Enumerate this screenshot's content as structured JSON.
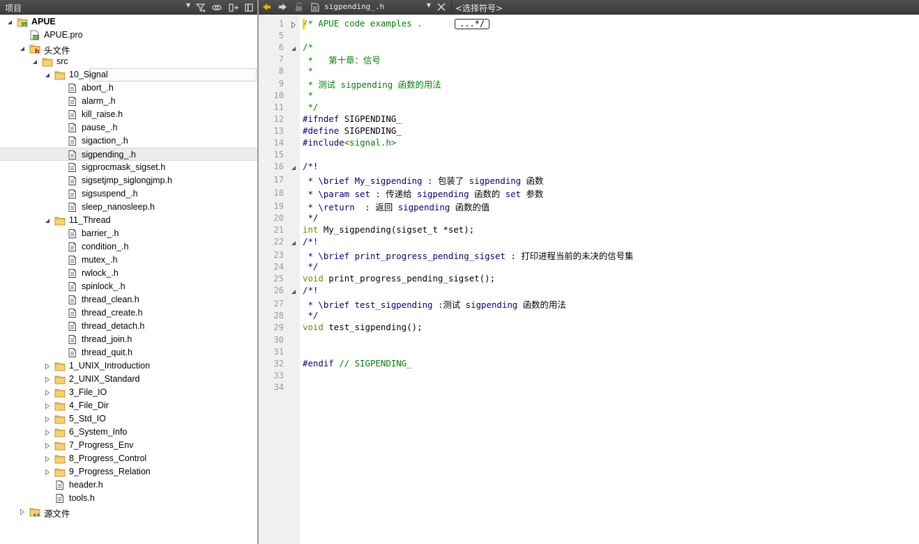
{
  "left_pane": {
    "header_title": "项目",
    "tree": [
      {
        "label": "APUE",
        "indent": 0,
        "expander": "open",
        "icon": "project-icon",
        "bold": true
      },
      {
        "label": "APUE.pro",
        "indent": 1,
        "expander": "none",
        "icon": "pro-file-icon"
      },
      {
        "label": "头文件",
        "indent": 1,
        "expander": "open",
        "icon": "headers-folder-icon"
      },
      {
        "label": "src",
        "indent": 2,
        "expander": "open",
        "icon": "folder-icon"
      },
      {
        "label": "10_Signal",
        "indent": 3,
        "expander": "open",
        "icon": "folder-icon",
        "state": "outline"
      },
      {
        "label": "abort_.h",
        "indent": 4,
        "expander": "none",
        "icon": "header-file-icon"
      },
      {
        "label": "alarm_.h",
        "indent": 4,
        "expander": "none",
        "icon": "header-file-icon"
      },
      {
        "label": "kill_raise.h",
        "indent": 4,
        "expander": "none",
        "icon": "header-file-icon"
      },
      {
        "label": "pause_.h",
        "indent": 4,
        "expander": "none",
        "icon": "header-file-icon"
      },
      {
        "label": "sigaction_.h",
        "indent": 4,
        "expander": "none",
        "icon": "header-file-icon"
      },
      {
        "label": "sigpending_.h",
        "indent": 4,
        "expander": "none",
        "icon": "header-file-icon",
        "state": "selected"
      },
      {
        "label": "sigprocmask_sigset.h",
        "indent": 4,
        "expander": "none",
        "icon": "header-file-icon"
      },
      {
        "label": "sigsetjmp_siglongjmp.h",
        "indent": 4,
        "expander": "none",
        "icon": "header-file-icon"
      },
      {
        "label": "sigsuspend_.h",
        "indent": 4,
        "expander": "none",
        "icon": "header-file-icon"
      },
      {
        "label": "sleep_nanosleep.h",
        "indent": 4,
        "expander": "none",
        "icon": "header-file-icon"
      },
      {
        "label": "11_Thread",
        "indent": 3,
        "expander": "open",
        "icon": "folder-icon"
      },
      {
        "label": "barrier_.h",
        "indent": 4,
        "expander": "none",
        "icon": "header-file-icon"
      },
      {
        "label": "condition_.h",
        "indent": 4,
        "expander": "none",
        "icon": "header-file-icon"
      },
      {
        "label": "mutex_.h",
        "indent": 4,
        "expander": "none",
        "icon": "header-file-icon"
      },
      {
        "label": "rwlock_.h",
        "indent": 4,
        "expander": "none",
        "icon": "header-file-icon"
      },
      {
        "label": "spinlock_.h",
        "indent": 4,
        "expander": "none",
        "icon": "header-file-icon"
      },
      {
        "label": "thread_clean.h",
        "indent": 4,
        "expander": "none",
        "icon": "header-file-icon"
      },
      {
        "label": "thread_create.h",
        "indent": 4,
        "expander": "none",
        "icon": "header-file-icon"
      },
      {
        "label": "thread_detach.h",
        "indent": 4,
        "expander": "none",
        "icon": "header-file-icon"
      },
      {
        "label": "thread_join.h",
        "indent": 4,
        "expander": "none",
        "icon": "header-file-icon"
      },
      {
        "label": "thread_quit.h",
        "indent": 4,
        "expander": "none",
        "icon": "header-file-icon"
      },
      {
        "label": "1_UNIX_Introduction",
        "indent": 3,
        "expander": "closed",
        "icon": "folder-icon"
      },
      {
        "label": "2_UNIX_Standard",
        "indent": 3,
        "expander": "closed",
        "icon": "folder-icon"
      },
      {
        "label": "3_File_IO",
        "indent": 3,
        "expander": "closed",
        "icon": "folder-icon"
      },
      {
        "label": "4_File_Dir",
        "indent": 3,
        "expander": "closed",
        "icon": "folder-icon"
      },
      {
        "label": "5_Std_IO",
        "indent": 3,
        "expander": "closed",
        "icon": "folder-icon"
      },
      {
        "label": "6_System_Info",
        "indent": 3,
        "expander": "closed",
        "icon": "folder-icon"
      },
      {
        "label": "7_Progress_Env",
        "indent": 3,
        "expander": "closed",
        "icon": "folder-icon"
      },
      {
        "label": "8_Progress_Control",
        "indent": 3,
        "expander": "closed",
        "icon": "folder-icon"
      },
      {
        "label": "9_Progress_Relation",
        "indent": 3,
        "expander": "closed",
        "icon": "folder-icon"
      },
      {
        "label": "header.h",
        "indent": 3,
        "expander": "none",
        "icon": "header-file-icon"
      },
      {
        "label": "tools.h",
        "indent": 3,
        "expander": "none",
        "icon": "header-file-icon"
      },
      {
        "label": "源文件",
        "indent": 1,
        "expander": "closed",
        "icon": "sources-folder-icon"
      }
    ]
  },
  "editor": {
    "file_name": "sigpending_.h",
    "symbol_placeholder": "<选择符号>",
    "collapsed_marker": "...*/",
    "line_numbers": [
      1,
      5,
      6,
      7,
      8,
      9,
      10,
      11,
      12,
      13,
      14,
      15,
      16,
      17,
      18,
      19,
      20,
      21,
      22,
      23,
      24,
      25,
      26,
      27,
      28,
      29,
      30,
      31,
      32,
      33,
      34
    ],
    "fold_markers": [
      {
        "line": 1,
        "kind": "collapsed"
      },
      {
        "line": 6,
        "kind": "expanded"
      },
      {
        "line": 16,
        "kind": "expanded"
      },
      {
        "line": 22,
        "kind": "expanded"
      },
      {
        "line": 26,
        "kind": "expanded"
      }
    ],
    "lines": [
      {
        "n": 1,
        "segs": [
          [
            "c-green",
            "/* APUE code examples . "
          ]
        ]
      },
      {
        "n": 5,
        "segs": []
      },
      {
        "n": 6,
        "segs": [
          [
            "c-green",
            "/*"
          ]
        ]
      },
      {
        "n": 7,
        "segs": [
          [
            "c-green",
            " *   第十章：信号"
          ]
        ]
      },
      {
        "n": 8,
        "segs": [
          [
            "c-green",
            " *"
          ]
        ]
      },
      {
        "n": 9,
        "segs": [
          [
            "c-green",
            " * 测试 sigpending 函数的用法"
          ]
        ]
      },
      {
        "n": 10,
        "segs": [
          [
            "c-green",
            " *"
          ]
        ]
      },
      {
        "n": 11,
        "segs": [
          [
            "c-green",
            " */"
          ]
        ]
      },
      {
        "n": 12,
        "segs": [
          [
            "c-navy",
            "#ifndef "
          ],
          [
            "c-black",
            "SIGPENDING_"
          ]
        ]
      },
      {
        "n": 13,
        "segs": [
          [
            "c-navy",
            "#define "
          ],
          [
            "c-black",
            "SIGPENDING_"
          ]
        ]
      },
      {
        "n": 14,
        "segs": [
          [
            "c-navy",
            "#include"
          ],
          [
            "c-green",
            "<signal.h>"
          ]
        ]
      },
      {
        "n": 15,
        "segs": []
      },
      {
        "n": 16,
        "segs": [
          [
            "c-navy",
            "/*!"
          ]
        ]
      },
      {
        "n": 17,
        "segs": [
          [
            "c-navy",
            " * \\brief My_sigpending : "
          ],
          [
            "c-black",
            "包装了 "
          ],
          [
            "c-navy",
            "sigpending "
          ],
          [
            "c-black",
            "函数"
          ]
        ]
      },
      {
        "n": 18,
        "segs": [
          [
            "c-navy",
            " * \\param set : "
          ],
          [
            "c-black",
            "传递给 "
          ],
          [
            "c-navy",
            "sigpending "
          ],
          [
            "c-black",
            "函数的 "
          ],
          [
            "c-navy",
            "set "
          ],
          [
            "c-black",
            "参数"
          ]
        ]
      },
      {
        "n": 19,
        "segs": [
          [
            "c-navy",
            " * \\return  : "
          ],
          [
            "c-black",
            "返回 "
          ],
          [
            "c-navy",
            "sigpending "
          ],
          [
            "c-black",
            "函数的值"
          ]
        ]
      },
      {
        "n": 20,
        "segs": [
          [
            "c-navy",
            " */"
          ]
        ]
      },
      {
        "n": 21,
        "segs": [
          [
            "c-kw",
            "int "
          ],
          [
            "c-black",
            "My_sigpending(sigset_t *set);"
          ]
        ]
      },
      {
        "n": 22,
        "segs": [
          [
            "c-navy",
            "/*!"
          ]
        ]
      },
      {
        "n": 23,
        "segs": [
          [
            "c-navy",
            " * \\brief print_progress_pending_sigset : "
          ],
          [
            "c-black",
            "打印进程当前的未决的信号集"
          ]
        ]
      },
      {
        "n": 24,
        "segs": [
          [
            "c-navy",
            " */"
          ]
        ]
      },
      {
        "n": 25,
        "segs": [
          [
            "c-kw",
            "void "
          ],
          [
            "c-black",
            "print_progress_pending_sigset();"
          ]
        ]
      },
      {
        "n": 26,
        "segs": [
          [
            "c-navy",
            "/*!"
          ]
        ]
      },
      {
        "n": 27,
        "segs": [
          [
            "c-navy",
            " * \\brief test_sigpending :"
          ],
          [
            "c-black",
            "测试 "
          ],
          [
            "c-navy",
            "sigpending "
          ],
          [
            "c-black",
            "函数的用法"
          ]
        ]
      },
      {
        "n": 28,
        "segs": [
          [
            "c-navy",
            " */"
          ]
        ]
      },
      {
        "n": 29,
        "segs": [
          [
            "c-kw",
            "void "
          ],
          [
            "c-black",
            "test_sigpending();"
          ]
        ]
      },
      {
        "n": 30,
        "segs": []
      },
      {
        "n": 31,
        "segs": []
      },
      {
        "n": 32,
        "segs": [
          [
            "c-navy",
            "#endif "
          ],
          [
            "c-green",
            "// SIGPENDING_"
          ]
        ]
      },
      {
        "n": 33,
        "segs": []
      },
      {
        "n": 34,
        "segs": []
      }
    ]
  },
  "colors": {
    "toolbar_bg": "#454545",
    "comment_green": "#008000",
    "doc_navy": "#000080",
    "keyword_olive": "#808000",
    "gutter_bg": "#f0f0f0",
    "folder_yellow": "#f2c94c"
  }
}
